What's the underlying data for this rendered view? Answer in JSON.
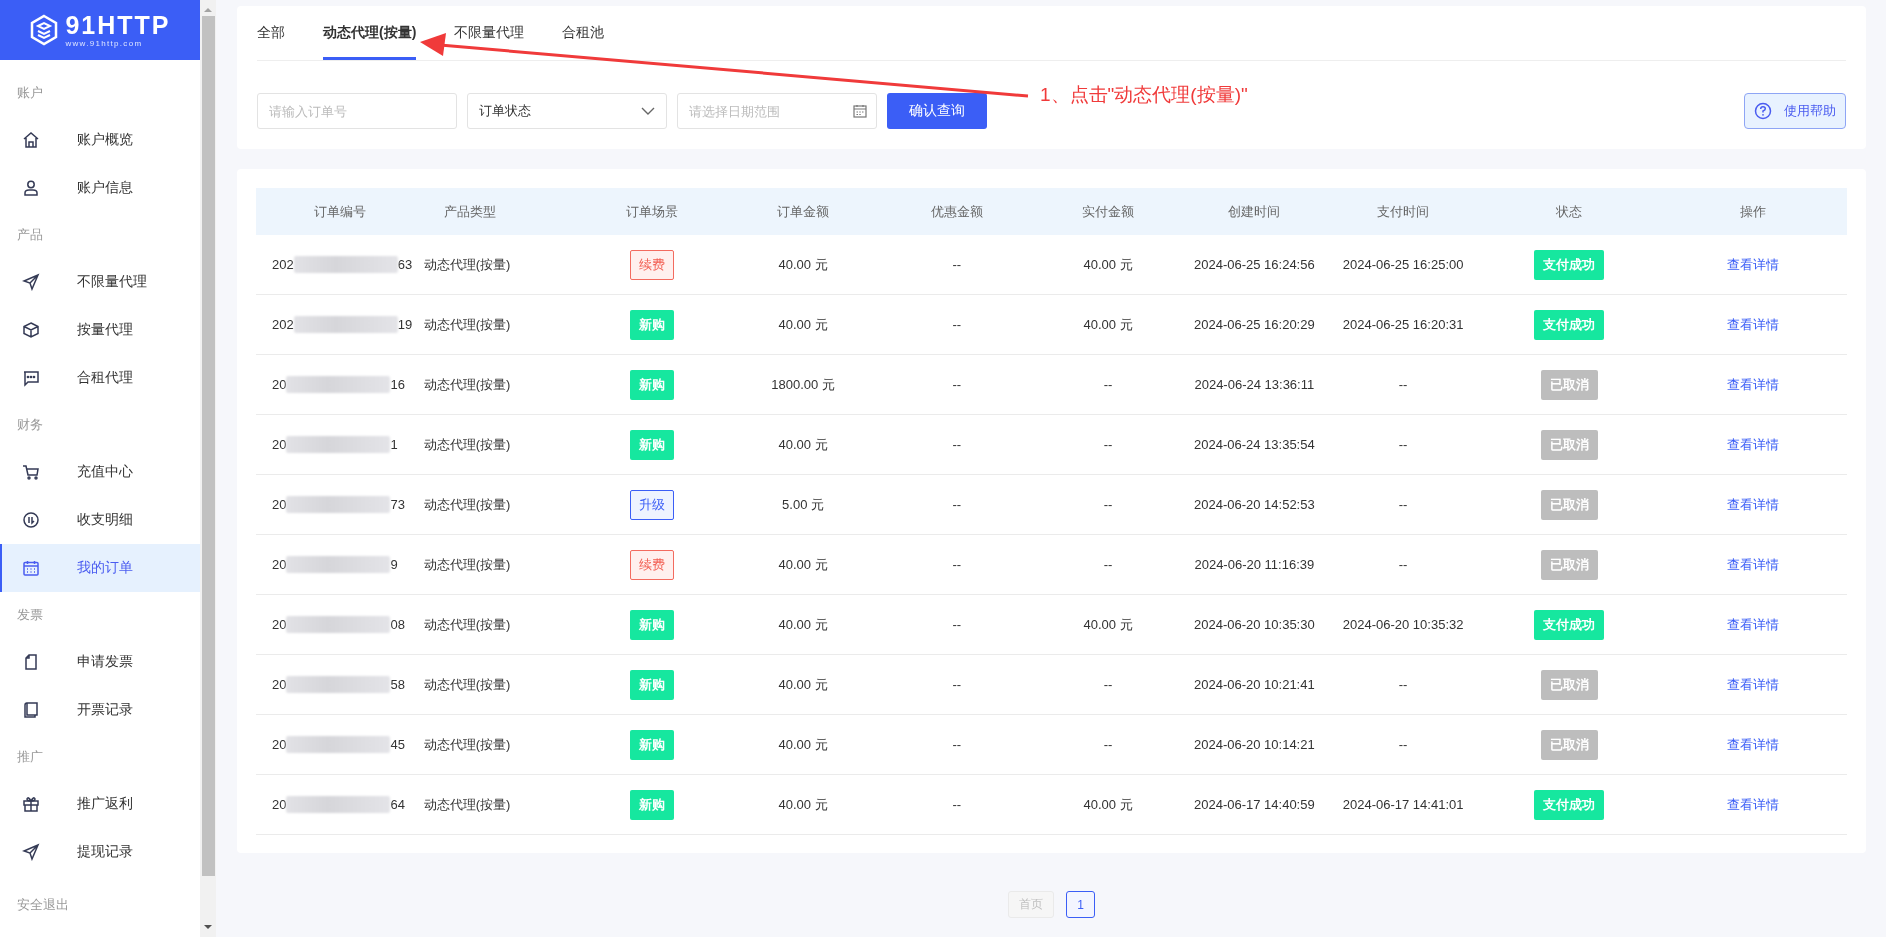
{
  "logo": {
    "name": "91HTTP",
    "url": "www.91http.com"
  },
  "sidebar": {
    "sections": [
      {
        "title": "账户",
        "items": [
          {
            "label": "账户概览",
            "selected": false
          },
          {
            "label": "账户信息",
            "selected": false
          }
        ]
      },
      {
        "title": "产品",
        "items": [
          {
            "label": "不限量代理",
            "selected": false
          },
          {
            "label": "按量代理",
            "selected": false
          },
          {
            "label": "合租代理",
            "selected": false
          }
        ]
      },
      {
        "title": "财务",
        "items": [
          {
            "label": "充值中心",
            "selected": false
          },
          {
            "label": "收支明细",
            "selected": false
          },
          {
            "label": "我的订单",
            "selected": true
          }
        ]
      },
      {
        "title": "发票",
        "items": [
          {
            "label": "申请发票",
            "selected": false
          },
          {
            "label": "开票记录",
            "selected": false
          }
        ]
      },
      {
        "title": "推广",
        "items": [
          {
            "label": "推广返利",
            "selected": false
          },
          {
            "label": "提现记录",
            "selected": false
          }
        ]
      }
    ],
    "logout": "安全退出"
  },
  "tabs": [
    {
      "label": "全部",
      "selected": false
    },
    {
      "label": "动态代理(按量)",
      "selected": true
    },
    {
      "label": "不限量代理",
      "selected": false
    },
    {
      "label": "合租池",
      "selected": false
    }
  ],
  "filters": {
    "order_no": {
      "placeholder": "请输入订单号"
    },
    "status": {
      "value": "订单状态"
    },
    "date": {
      "placeholder": "请选择日期范围"
    },
    "search_button": "确认查询",
    "help_button": "使用帮助"
  },
  "annotation": "1、点击\"动态代理(按量)\"",
  "table": {
    "columns": [
      "订单编号",
      "产品类型",
      "订单场景",
      "订单金额",
      "优惠金额",
      "实付金额",
      "创建时间",
      "支付时间",
      "状态",
      "操作"
    ],
    "rows": [
      {
        "order_prefix": "202",
        "order_suffix": "63",
        "product": "动态代理(按量)",
        "scene": {
          "label": "续费",
          "kind": "renew"
        },
        "amount": "40.00 元",
        "discount": "--",
        "paid": "40.00 元",
        "created": "2024-06-25 16:24:56",
        "paid_at": "2024-06-25 16:25:00",
        "status": {
          "label": "支付成功",
          "kind": "success"
        },
        "action": "查看详情"
      },
      {
        "order_prefix": "202",
        "order_suffix": "19",
        "product": "动态代理(按量)",
        "scene": {
          "label": "新购",
          "kind": "new"
        },
        "amount": "40.00 元",
        "discount": "--",
        "paid": "40.00 元",
        "created": "2024-06-25 16:20:29",
        "paid_at": "2024-06-25 16:20:31",
        "status": {
          "label": "支付成功",
          "kind": "success"
        },
        "action": "查看详情"
      },
      {
        "order_prefix": "20",
        "order_suffix": "16",
        "product": "动态代理(按量)",
        "scene": {
          "label": "新购",
          "kind": "new"
        },
        "amount": "1800.00 元",
        "discount": "--",
        "paid": "--",
        "created": "2024-06-24 13:36:11",
        "paid_at": "--",
        "status": {
          "label": "已取消",
          "kind": "cancelled"
        },
        "action": "查看详情"
      },
      {
        "order_prefix": "20",
        "order_suffix": "1",
        "product": "动态代理(按量)",
        "scene": {
          "label": "新购",
          "kind": "new"
        },
        "amount": "40.00 元",
        "discount": "--",
        "paid": "--",
        "created": "2024-06-24 13:35:54",
        "paid_at": "--",
        "status": {
          "label": "已取消",
          "kind": "cancelled"
        },
        "action": "查看详情"
      },
      {
        "order_prefix": "20",
        "order_suffix": "73",
        "product": "动态代理(按量)",
        "scene": {
          "label": "升级",
          "kind": "upgrade"
        },
        "amount": "5.00 元",
        "discount": "--",
        "paid": "--",
        "created": "2024-06-20 14:52:53",
        "paid_at": "--",
        "status": {
          "label": "已取消",
          "kind": "cancelled"
        },
        "action": "查看详情"
      },
      {
        "order_prefix": "20",
        "order_suffix": "9",
        "product": "动态代理(按量)",
        "scene": {
          "label": "续费",
          "kind": "renew"
        },
        "amount": "40.00 元",
        "discount": "--",
        "paid": "--",
        "created": "2024-06-20 11:16:39",
        "paid_at": "--",
        "status": {
          "label": "已取消",
          "kind": "cancelled"
        },
        "action": "查看详情"
      },
      {
        "order_prefix": "20",
        "order_suffix": "08",
        "product": "动态代理(按量)",
        "scene": {
          "label": "新购",
          "kind": "new"
        },
        "amount": "40.00 元",
        "discount": "--",
        "paid": "40.00 元",
        "created": "2024-06-20 10:35:30",
        "paid_at": "2024-06-20 10:35:32",
        "status": {
          "label": "支付成功",
          "kind": "success"
        },
        "action": "查看详情"
      },
      {
        "order_prefix": "20",
        "order_suffix": "58",
        "product": "动态代理(按量)",
        "scene": {
          "label": "新购",
          "kind": "new"
        },
        "amount": "40.00 元",
        "discount": "--",
        "paid": "--",
        "created": "2024-06-20 10:21:41",
        "paid_at": "--",
        "status": {
          "label": "已取消",
          "kind": "cancelled"
        },
        "action": "查看详情"
      },
      {
        "order_prefix": "20",
        "order_suffix": "45",
        "product": "动态代理(按量)",
        "scene": {
          "label": "新购",
          "kind": "new"
        },
        "amount": "40.00 元",
        "discount": "--",
        "paid": "--",
        "created": "2024-06-20 10:14:21",
        "paid_at": "--",
        "status": {
          "label": "已取消",
          "kind": "cancelled"
        },
        "action": "查看详情"
      },
      {
        "order_prefix": "20",
        "order_suffix": "64",
        "product": "动态代理(按量)",
        "scene": {
          "label": "新购",
          "kind": "new"
        },
        "amount": "40.00 元",
        "discount": "--",
        "paid": "40.00 元",
        "created": "2024-06-17 14:40:59",
        "paid_at": "2024-06-17 14:41:01",
        "status": {
          "label": "支付成功",
          "kind": "success"
        },
        "action": "查看详情"
      }
    ]
  },
  "pagination": {
    "first": {
      "label": "首页",
      "disabled": true
    },
    "pages": [
      {
        "label": "1",
        "selected": true
      }
    ]
  }
}
